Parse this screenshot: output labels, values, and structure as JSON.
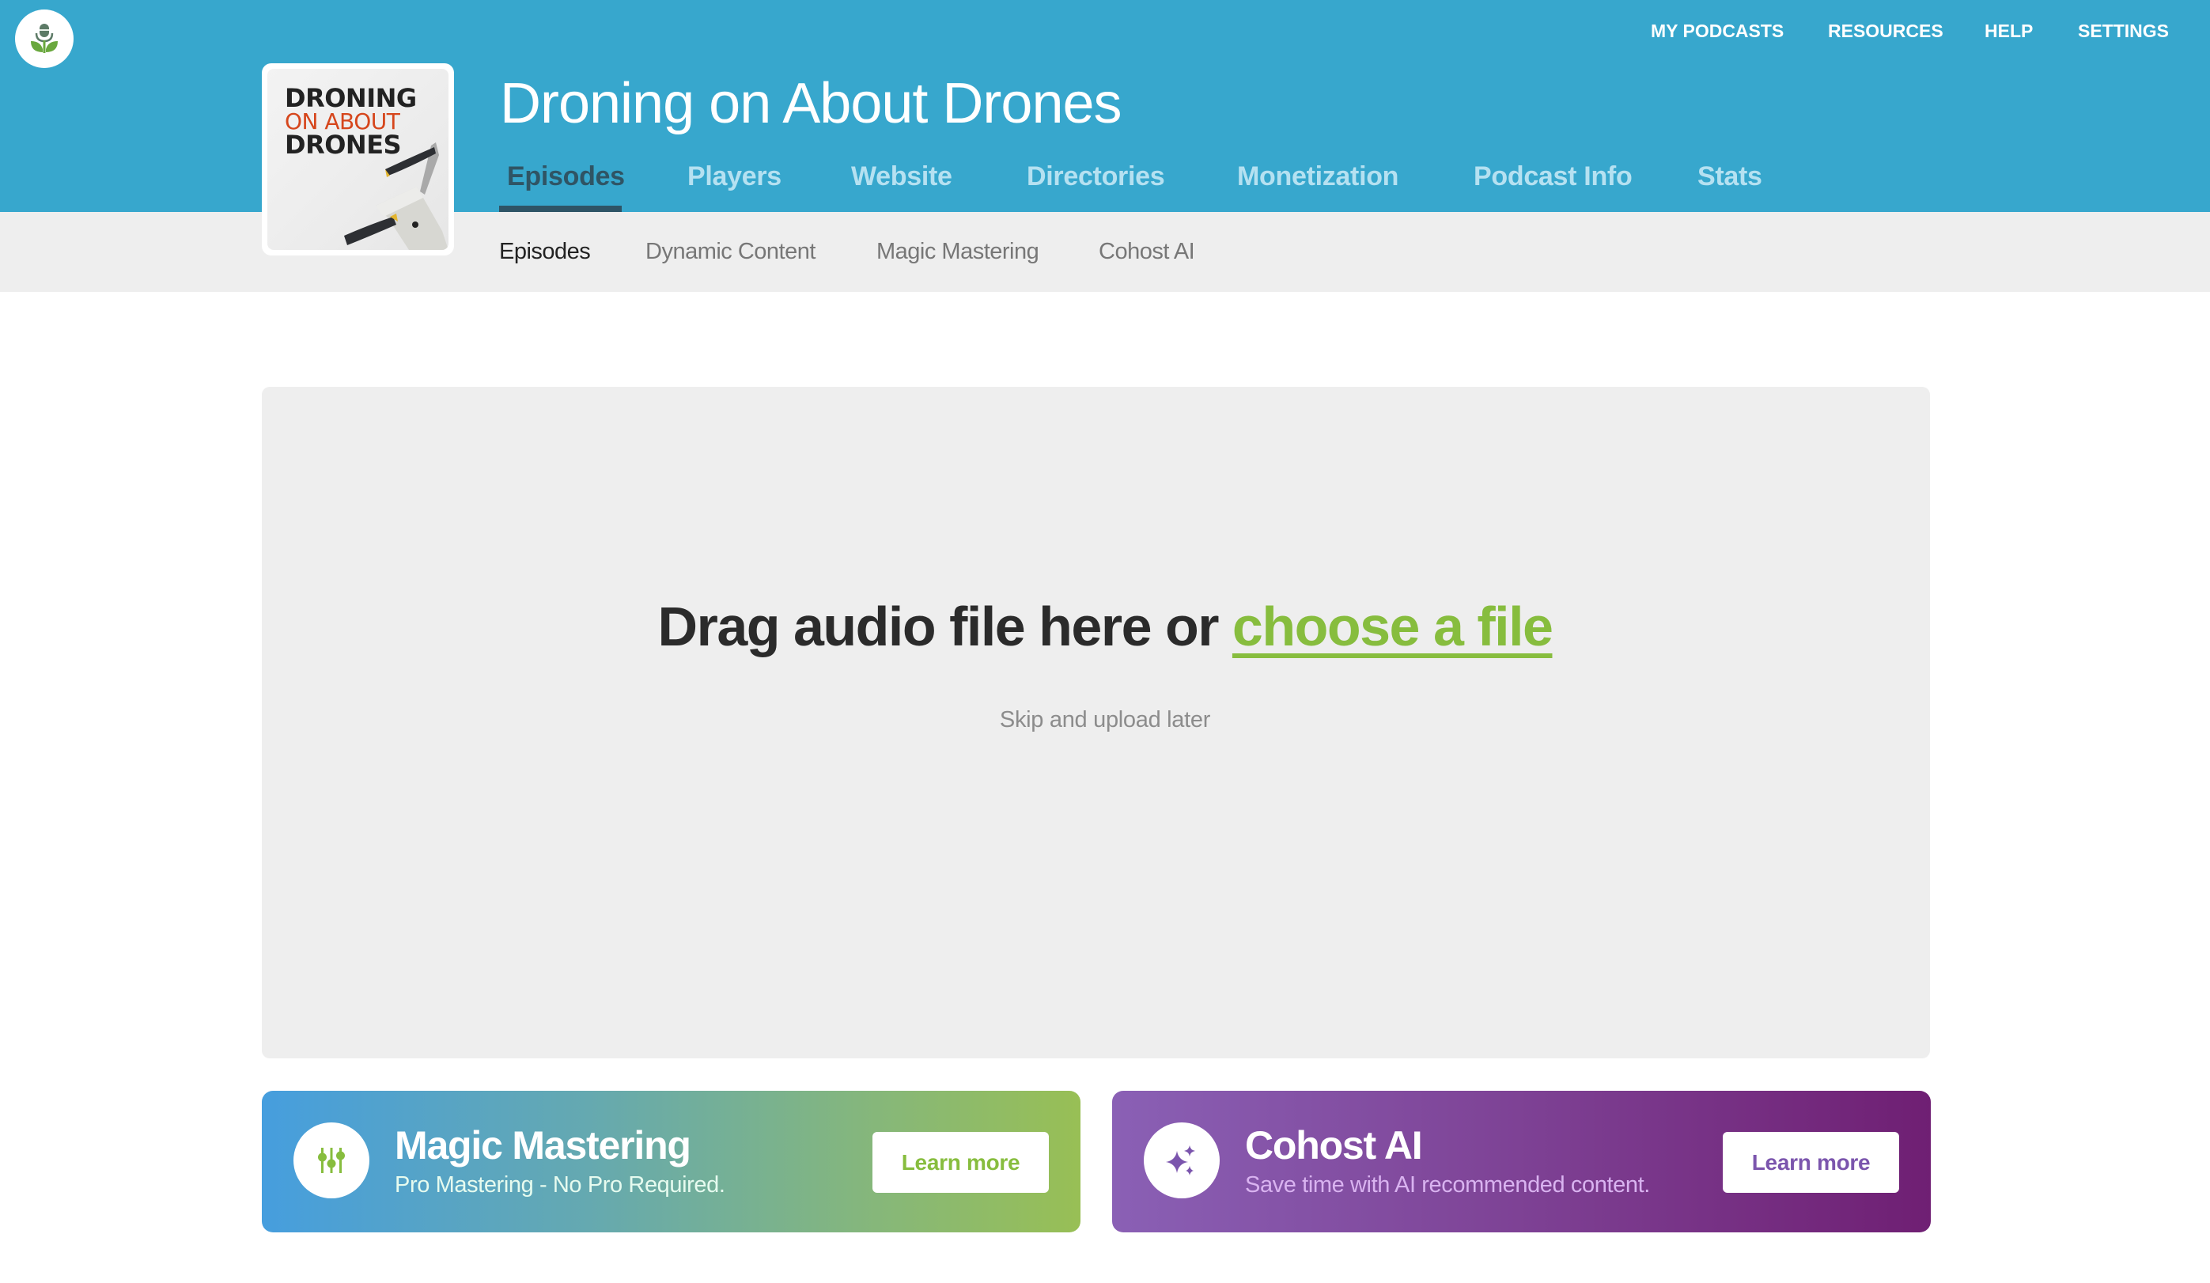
{
  "colors": {
    "header_bg": "#37a7cd",
    "subnav_bg": "#eeeeee",
    "active_tab": "#2f5464",
    "inactive_tab": "#b5e1f1",
    "link_green": "#87bd3e",
    "cohost_purple": "#7b55ad",
    "cover_accent": "#d6461c"
  },
  "brand": {
    "logo_icon": "microphone-sprout-logo"
  },
  "top_nav": [
    {
      "label": "MY PODCASTS"
    },
    {
      "label": "RESOURCES"
    },
    {
      "label": "HELP"
    },
    {
      "label": "SETTINGS"
    }
  ],
  "podcast": {
    "title": "Droning on About Drones",
    "cover": {
      "line1": "DRONING",
      "line2": "ON ABOUT",
      "line3": "DRONES"
    }
  },
  "main_tabs": [
    {
      "label": "Episodes",
      "active": true
    },
    {
      "label": "Players",
      "active": false
    },
    {
      "label": "Website",
      "active": false
    },
    {
      "label": "Directories",
      "active": false
    },
    {
      "label": "Monetization",
      "active": false
    },
    {
      "label": "Podcast Info",
      "active": false
    },
    {
      "label": "Stats",
      "active": false
    }
  ],
  "sub_tabs": [
    {
      "label": "Episodes",
      "active": true
    },
    {
      "label": "Dynamic Content",
      "active": false
    },
    {
      "label": "Magic Mastering",
      "active": false
    },
    {
      "label": "Cohost AI",
      "active": false
    }
  ],
  "dropzone": {
    "headline": "Drag audio file here or ",
    "choose_link": "choose a file",
    "skip_label": "Skip and upload later"
  },
  "promos": [
    {
      "title": "Magic Mastering",
      "subtitle": "Pro Mastering - No Pro Required.",
      "button": "Learn more",
      "icon": "equalizer-sliders-icon"
    },
    {
      "title": "Cohost AI",
      "subtitle": "Save time with AI recommended content.",
      "button": "Learn more",
      "icon": "sparkles-icon"
    }
  ]
}
